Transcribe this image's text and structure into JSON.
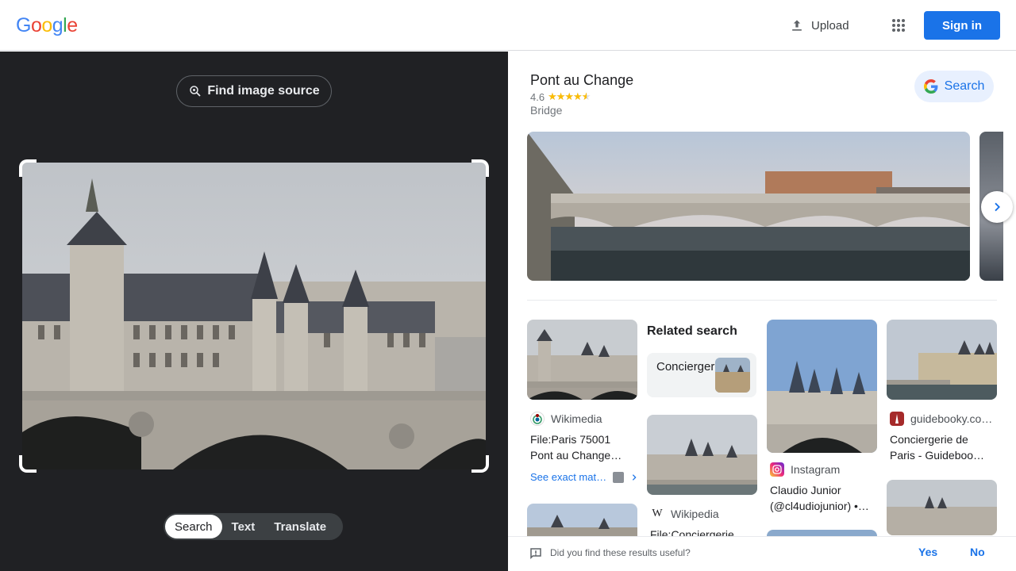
{
  "header": {
    "logo": [
      "G",
      "o",
      "o",
      "g",
      "l",
      "e"
    ],
    "logo_colors": [
      "#4285F4",
      "#EA4335",
      "#FBBC05",
      "#4285F4",
      "#34A853",
      "#EA4335"
    ],
    "upload_label": "Upload",
    "signin_label": "Sign in"
  },
  "left": {
    "find_source_label": "Find image source",
    "modes": [
      "Search",
      "Text",
      "Translate"
    ],
    "active_mode": "Search"
  },
  "knowledge_panel": {
    "title": "Pont au Change",
    "rating": "4.6",
    "stars": "★★★★★",
    "star_fraction": 0.92,
    "type": "Bridge",
    "search_label": "Search"
  },
  "results": {
    "card1": {
      "source": "Wikimedia",
      "title": "File:Paris 75001 Pont au Change…",
      "exact_match": "See exact mat…"
    },
    "related": {
      "heading": "Related search",
      "chip_label": "Conciergerie"
    },
    "card3": {
      "source": "Instagram",
      "title": "Claudio Junior (@cl4udiojunior) •…"
    },
    "card4": {
      "source": "guidebooky.co…",
      "title": "Conciergerie de Paris - Guideboo…"
    },
    "card5": {
      "source": "Wikipedia",
      "title": "File:Conciergerie…"
    }
  },
  "feedback": {
    "question": "Did you find these results useful?",
    "yes": "Yes",
    "no": "No"
  },
  "colors": {
    "accent": "#1a73e8",
    "dark_bg": "#202124",
    "star": "#fbbc04"
  }
}
